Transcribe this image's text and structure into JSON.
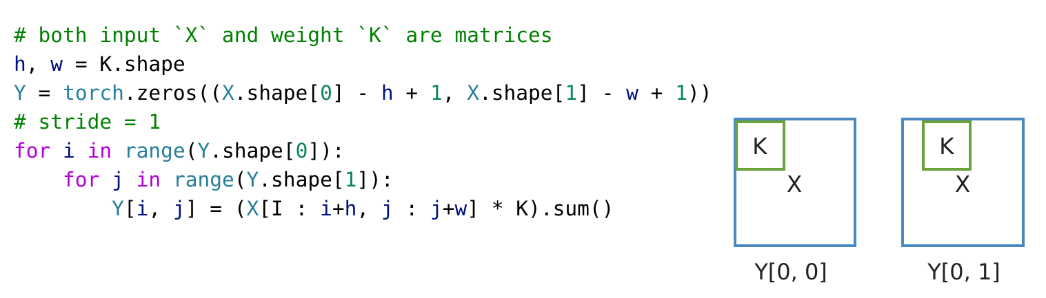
{
  "code": {
    "lines": [
      [
        {
          "t": "# both input `X` and weight `K` are matrices",
          "c": "comment"
        }
      ],
      [
        {
          "t": "h",
          "c": "var"
        },
        {
          "t": ", ",
          "c": "plain"
        },
        {
          "t": "w",
          "c": "var"
        },
        {
          "t": " = K.shape",
          "c": "plain"
        }
      ],
      [
        {
          "t": "Y",
          "c": "name"
        },
        {
          "t": " = ",
          "c": "plain"
        },
        {
          "t": "torch",
          "c": "name"
        },
        {
          "t": ".zeros((",
          "c": "plain"
        },
        {
          "t": "X",
          "c": "name"
        },
        {
          "t": ".shape[",
          "c": "plain"
        },
        {
          "t": "0",
          "c": "num"
        },
        {
          "t": "] - ",
          "c": "plain"
        },
        {
          "t": "h",
          "c": "var"
        },
        {
          "t": " + ",
          "c": "plain"
        },
        {
          "t": "1",
          "c": "num"
        },
        {
          "t": ", ",
          "c": "plain"
        },
        {
          "t": "X",
          "c": "name"
        },
        {
          "t": ".shape[",
          "c": "plain"
        },
        {
          "t": "1",
          "c": "num"
        },
        {
          "t": "] - ",
          "c": "plain"
        },
        {
          "t": "w",
          "c": "var"
        },
        {
          "t": " + ",
          "c": "plain"
        },
        {
          "t": "1",
          "c": "num"
        },
        {
          "t": "))",
          "c": "plain"
        }
      ],
      [
        {
          "t": "# stride = 1",
          "c": "comment"
        }
      ],
      [
        {
          "t": "for",
          "c": "kw"
        },
        {
          "t": " ",
          "c": "plain"
        },
        {
          "t": "i",
          "c": "var"
        },
        {
          "t": " ",
          "c": "plain"
        },
        {
          "t": "in",
          "c": "kw"
        },
        {
          "t": " ",
          "c": "plain"
        },
        {
          "t": "range",
          "c": "name"
        },
        {
          "t": "(",
          "c": "plain"
        },
        {
          "t": "Y",
          "c": "name"
        },
        {
          "t": ".shape[",
          "c": "plain"
        },
        {
          "t": "0",
          "c": "num"
        },
        {
          "t": "]):",
          "c": "plain"
        }
      ],
      [
        {
          "t": "    ",
          "c": "plain"
        },
        {
          "t": "for",
          "c": "kw"
        },
        {
          "t": " ",
          "c": "plain"
        },
        {
          "t": "j",
          "c": "var"
        },
        {
          "t": " ",
          "c": "plain"
        },
        {
          "t": "in",
          "c": "kw"
        },
        {
          "t": " ",
          "c": "plain"
        },
        {
          "t": "range",
          "c": "name"
        },
        {
          "t": "(",
          "c": "plain"
        },
        {
          "t": "Y",
          "c": "name"
        },
        {
          "t": ".shape[",
          "c": "plain"
        },
        {
          "t": "1",
          "c": "num"
        },
        {
          "t": "]):",
          "c": "plain"
        }
      ],
      [
        {
          "t": "        ",
          "c": "plain"
        },
        {
          "t": "Y",
          "c": "name"
        },
        {
          "t": "[",
          "c": "plain"
        },
        {
          "t": "i",
          "c": "var"
        },
        {
          "t": ", ",
          "c": "plain"
        },
        {
          "t": "j",
          "c": "var"
        },
        {
          "t": "] = (",
          "c": "plain"
        },
        {
          "t": "X",
          "c": "name"
        },
        {
          "t": "[I : ",
          "c": "plain"
        },
        {
          "t": "i",
          "c": "var"
        },
        {
          "t": "+",
          "c": "plain"
        },
        {
          "t": "h",
          "c": "var"
        },
        {
          "t": ", ",
          "c": "plain"
        },
        {
          "t": "j",
          "c": "var"
        },
        {
          "t": " : ",
          "c": "plain"
        },
        {
          "t": "j",
          "c": "var"
        },
        {
          "t": "+",
          "c": "plain"
        },
        {
          "t": "w",
          "c": "var"
        },
        {
          "t": "] * K).sum()",
          "c": "plain"
        }
      ]
    ]
  },
  "colors": {
    "comment": "#008000",
    "var": "#001080",
    "name": "#267f99",
    "num": "#098658",
    "kw": "#af00db",
    "plain": "#000000",
    "outer_box": "#4a89bd",
    "kernel_box": "#6aa33b"
  },
  "diagram": {
    "panels": [
      {
        "input_label": "X",
        "kernel_label": "K",
        "caption": "Y[0, 0]"
      },
      {
        "input_label": "X",
        "kernel_label": "K",
        "caption": "Y[0, 1]"
      }
    ]
  }
}
